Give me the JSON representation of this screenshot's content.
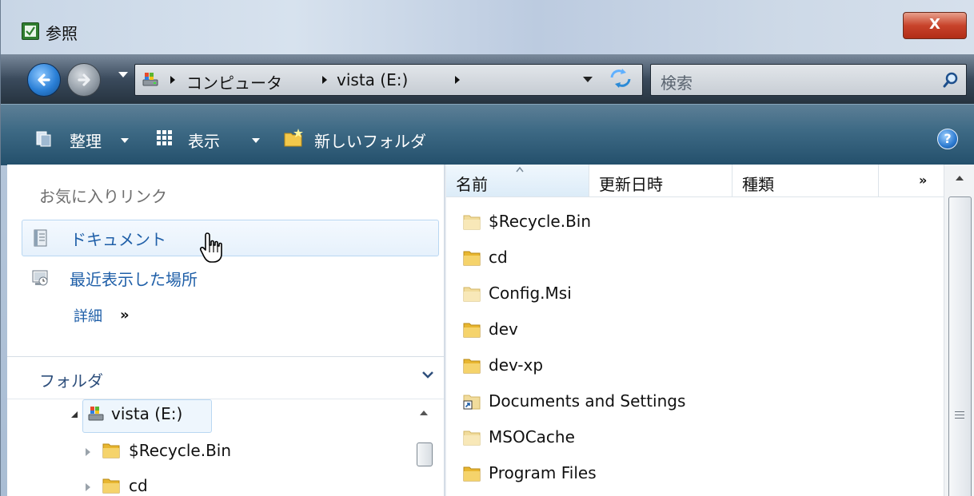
{
  "window": {
    "title": "参照",
    "close_label": "X"
  },
  "address_bar": {
    "crumbs": [
      "コンピュータ",
      "vista (E:)"
    ],
    "search_placeholder": "検索"
  },
  "toolbar": {
    "organize": "整理",
    "views": "表示",
    "new_folder": "新しいフォルダ",
    "help": "?"
  },
  "navigation": {
    "favorites_header": "お気に入りリンク",
    "favorites": [
      {
        "label": "ドキュメント",
        "icon": "documents-icon"
      },
      {
        "label": "最近表示した場所",
        "icon": "recent-places-icon"
      }
    ],
    "more_label": "詳細",
    "more_chevron": "»",
    "folders_header": "フォルダ",
    "tree": [
      {
        "label": "vista (E:)",
        "icon": "drive-icon",
        "expanded": true,
        "selected": true
      },
      {
        "label": "$Recycle.Bin",
        "icon": "folder-icon",
        "expanded": false
      },
      {
        "label": "cd",
        "icon": "folder-icon",
        "expanded": false
      }
    ]
  },
  "file_list": {
    "columns": [
      "名前",
      "更新日時",
      "種類"
    ],
    "sorted_column": "名前",
    "more_columns": "»",
    "items": [
      {
        "name": "$Recycle.Bin",
        "icon": "folder-pale-icon"
      },
      {
        "name": "cd",
        "icon": "folder-icon"
      },
      {
        "name": "Config.Msi",
        "icon": "folder-pale-icon"
      },
      {
        "name": "dev",
        "icon": "folder-icon"
      },
      {
        "name": "dev-xp",
        "icon": "folder-icon"
      },
      {
        "name": "Documents and Settings",
        "icon": "shortcut-folder-icon"
      },
      {
        "name": "MSOCache",
        "icon": "folder-pale-icon"
      },
      {
        "name": "Program Files",
        "icon": "folder-icon"
      }
    ]
  },
  "colors": {
    "link_blue": "#1f5fa8",
    "toolbar_teal": "#3f6b86",
    "folder_yellow": "#e8b630"
  }
}
